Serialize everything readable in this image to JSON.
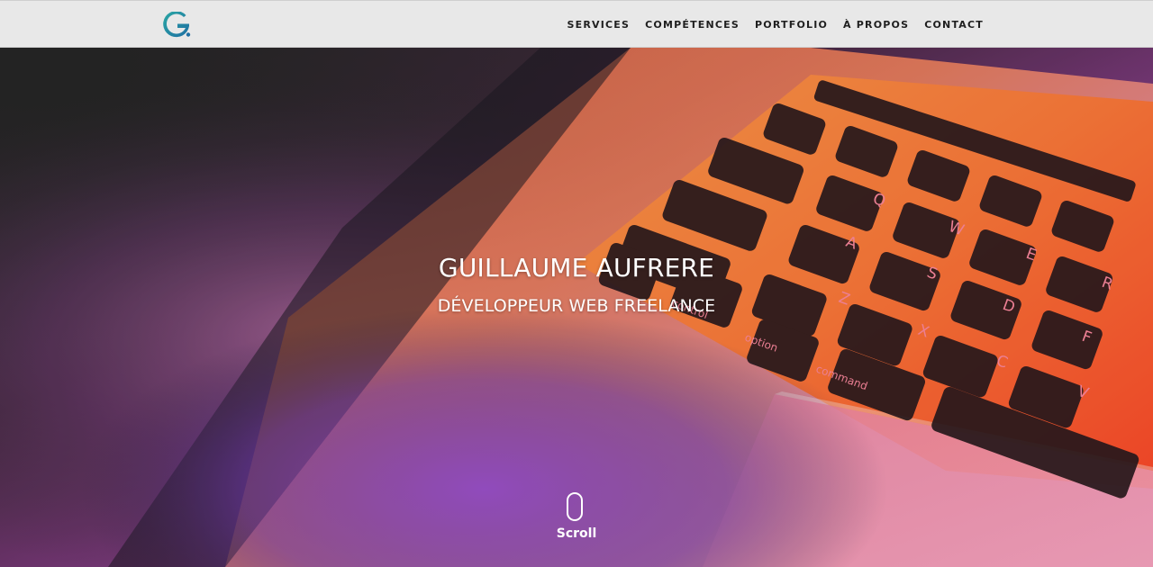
{
  "nav": {
    "logo_letter": "G",
    "links": [
      "SERVICES",
      "COMPÉTENCES",
      "PORTFOLIO",
      "À PROPOS",
      "CONTACT"
    ]
  },
  "hero": {
    "title": "GUILLAUME AUFRERE",
    "subtitle": "DÉVELOPPEUR WEB FREELANCE",
    "scroll_label": "Scroll",
    "keys": [
      "Q",
      "W",
      "E",
      "R",
      "A",
      "S",
      "D",
      "F",
      "Z",
      "X",
      "C",
      "V",
      "option",
      "command",
      "control"
    ]
  },
  "colors": {
    "nav_bg": "#e8e8e8",
    "logo_blue": "#1f6fa3",
    "logo_teal": "#2aa7a3",
    "keyboard_orange": "#ff8a3d",
    "keyboard_pink": "#e24a8a",
    "hero_purple": "#7a3fa8"
  }
}
